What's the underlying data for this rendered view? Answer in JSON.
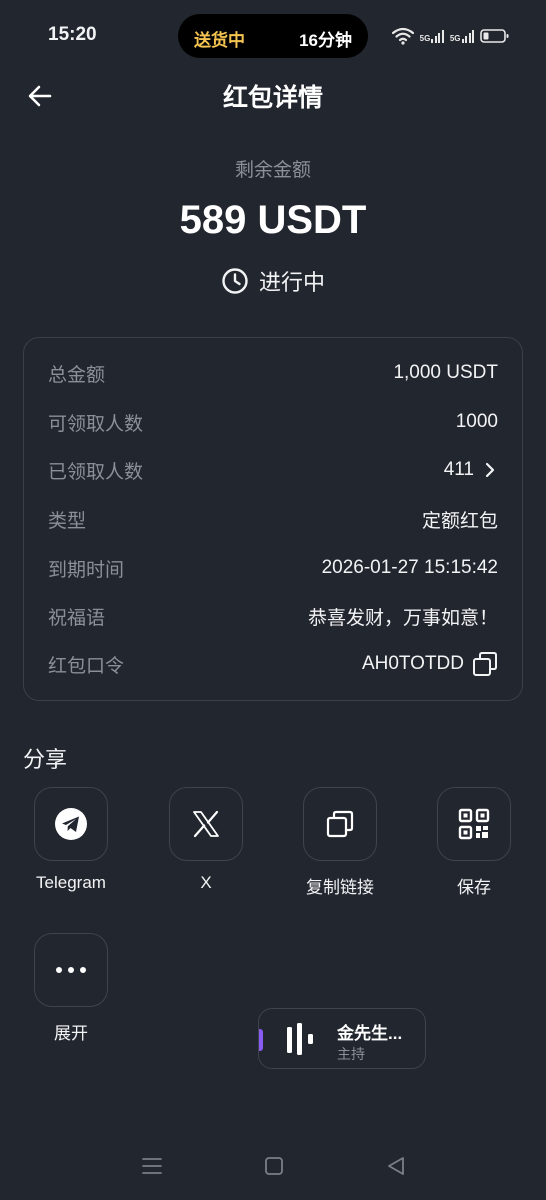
{
  "status_bar": {
    "time": "15:20",
    "island_status": "送货中",
    "island_minutes": "16分钟",
    "network_1": "5G",
    "network_2": "5G"
  },
  "header": {
    "title": "红包详情",
    "back_icon": "arrow-left-icon"
  },
  "balance": {
    "label": "剩余金额",
    "amount": "589 USDT",
    "status": "进行中",
    "status_icon": "clock-icon"
  },
  "details": [
    {
      "label": "总金额",
      "value": "1,000 USDT"
    },
    {
      "label": "可领取人数",
      "value": "1000"
    },
    {
      "label": "已领取人数",
      "value": "411"
    },
    {
      "label": "类型",
      "value": "定额红包"
    },
    {
      "label": "到期时间",
      "value": "2026-01-27 15:15:42"
    },
    {
      "label": "祝福语",
      "value": "恭喜发财，万事如意！"
    },
    {
      "label": "红包口令",
      "value": "AH0TOTDD"
    }
  ],
  "share": {
    "title": "分享",
    "items": [
      {
        "label": "Telegram",
        "icon": "telegram-icon"
      },
      {
        "label": "X",
        "icon": "x-logo-icon"
      },
      {
        "label": "复制链接",
        "icon": "copy-link-icon"
      },
      {
        "label": "保存",
        "icon": "qr-code-icon"
      },
      {
        "label": "展开",
        "icon": "more-icon"
      }
    ]
  },
  "player": {
    "name": "金先生...",
    "role": "主持"
  },
  "colors": {
    "background": "#22262e",
    "border": "#3a3f48",
    "muted_text": "#8a8f99",
    "island_accent": "#f5c451",
    "player_accent": "#8a5cf5"
  }
}
